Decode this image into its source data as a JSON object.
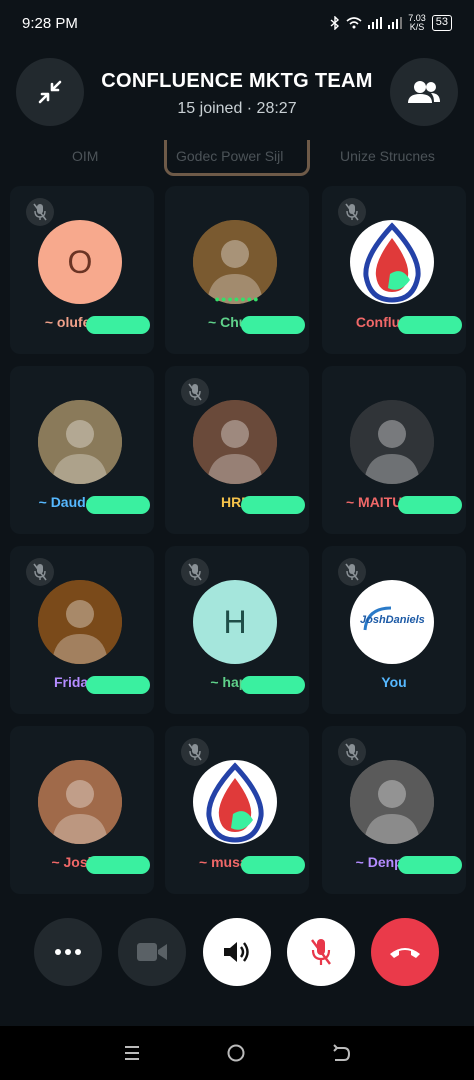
{
  "status": {
    "time": "9:28 PM",
    "speed_value": "7.03",
    "speed_unit": "K/S",
    "battery": "53"
  },
  "header": {
    "title": "CONFLUENCE MKTG TEAM",
    "subtitle": "15 joined · 28:27"
  },
  "partial_row": {
    "left": "OIM",
    "center": "Godec Power Sijl",
    "right": "Unize Strucnes"
  },
  "participants": [
    {
      "name": "~ olufemiol",
      "name_color": "#f0a18a",
      "avatar_type": "letter",
      "letter": "O",
      "avatar_bg": "#f7a98d",
      "letter_color": "#6a3424",
      "muted": true
    },
    {
      "name": "~ Chukw",
      "name_color": "#5fd18a",
      "avatar_type": "photo",
      "avatar_bg": "#7a5a30",
      "muted": false
    },
    {
      "name": "Confluence",
      "name_color": "#f06868",
      "avatar_type": "logo-drop",
      "avatar_bg": "#ffffff",
      "muted": true
    },
    {
      "name": "~ Dauda Mus",
      "name_color": "#56b8ff",
      "avatar_type": "photo",
      "avatar_bg": "#8a7a5a",
      "muted": false
    },
    {
      "name": "HRM",
      "name_color": "#f6c34b",
      "avatar_type": "photo",
      "avatar_bg": "#6a4a3a",
      "muted": true
    },
    {
      "name": "~ MAITURARE",
      "name_color": "#f06868",
      "avatar_type": "photo",
      "avatar_bg": "#303438",
      "muted": false
    },
    {
      "name": "Friday C",
      "name_color": "#b48cff",
      "avatar_type": "photo",
      "avatar_bg": "#7a4a1a",
      "muted": true
    },
    {
      "name": "~ happy",
      "name_color": "#5fd18a",
      "avatar_type": "letter",
      "letter": "H",
      "avatar_bg": "#a5e6dc",
      "letter_color": "#1f4e48",
      "muted": true
    },
    {
      "name": "You",
      "name_color": "#56b8ff",
      "avatar_type": "logo-josh",
      "avatar_bg": "#ffffff",
      "muted": true
    },
    {
      "name": "~ Joshua",
      "name_color": "#f06868",
      "avatar_type": "photo",
      "avatar_bg": "#a06a4a",
      "muted": false
    },
    {
      "name": "~ musa 525",
      "name_color": "#f06868",
      "avatar_type": "logo-drop",
      "avatar_bg": "#ffffff",
      "muted": true
    },
    {
      "name": "~ Denpec N",
      "name_color": "#b48cff",
      "avatar_type": "photo",
      "avatar_bg": "#5a5a5a",
      "muted": true
    }
  ],
  "josh_logo_text": "JoshDaniels",
  "controls": [
    {
      "name": "more-options-button",
      "icon": "more-dots-icon",
      "bg": "#22292e"
    },
    {
      "name": "video-button",
      "icon": "video-off-icon",
      "bg": "#22292e"
    },
    {
      "name": "speaker-button",
      "icon": "speaker-icon",
      "bg": "#ffffff"
    },
    {
      "name": "mute-button",
      "icon": "mic-off-icon",
      "bg": "#ffffff"
    },
    {
      "name": "end-call-button",
      "icon": "phone-hangup-icon",
      "bg": "#ea3a4a"
    }
  ]
}
